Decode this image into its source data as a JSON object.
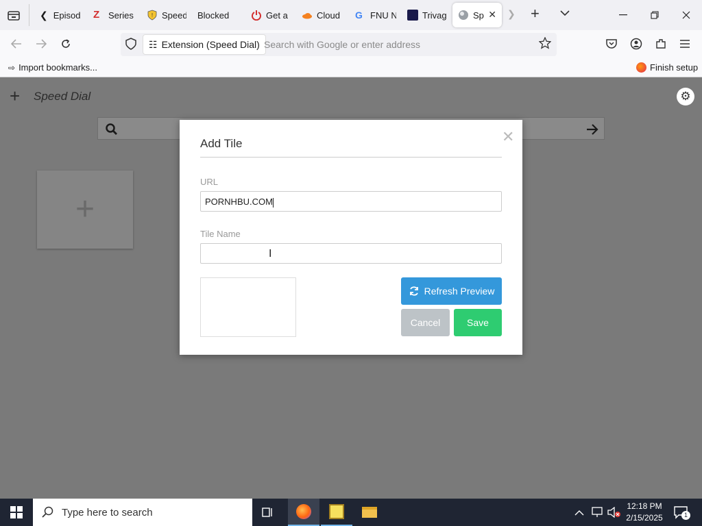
{
  "tabs": [
    {
      "label": "Episod",
      "icon": "chevron-left-icon"
    },
    {
      "label": "Series",
      "icon": "zeta-logo-icon"
    },
    {
      "label": "Speed",
      "icon": "shield-icon"
    },
    {
      "label": "Blocked",
      "icon": ""
    },
    {
      "label": "Get a",
      "icon": "power-icon"
    },
    {
      "label": "Cloud",
      "icon": "cloudflare-icon"
    },
    {
      "label": "FNU N",
      "icon": "google-icon"
    },
    {
      "label": "Trivag",
      "icon": "tab-favicon-icon"
    },
    {
      "label": "Sp",
      "icon": "globe-icon"
    }
  ],
  "navbar": {
    "extension_chip": "Extension (Speed Dial)",
    "placeholder": "Search with Google or enter address"
  },
  "bookmarks": {
    "import": "Import bookmarks...",
    "finish": "Finish setup"
  },
  "speeddial": {
    "title": "Speed Dial"
  },
  "modal": {
    "title": "Add Tile",
    "url_label": "URL",
    "url_value": "PORNHBU.COM",
    "name_label": "Tile Name",
    "name_value": "",
    "refresh": "Refresh Preview",
    "cancel": "Cancel",
    "save": "Save"
  },
  "taskbar": {
    "search": "Type here to search",
    "time": "12:18 PM",
    "date": "2/15/2025",
    "notifications": "1"
  },
  "colors": {
    "accent": "#3498db",
    "save": "#2ecc71",
    "cancel": "#bdc3c7",
    "dim": "#7a7a7a"
  }
}
